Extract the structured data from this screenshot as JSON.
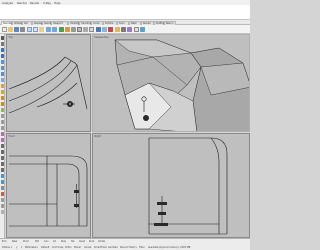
{
  "menu": [
    "Analyze",
    "Render",
    "Panels",
    "V-Ray",
    "Help"
  ],
  "tabs": [
    "Standard",
    "CPlanes",
    "Set View",
    "Display",
    "Select",
    "Viewport Layout",
    "Visibility",
    "Transform",
    "Curve Tools",
    "Surface Tools",
    "Solid Tools",
    "Mesh Tools",
    "Render Tools",
    "Drafting",
    "New in V7"
  ],
  "viewports": {
    "top": "Top",
    "perspective": "Perspective",
    "front": "Front",
    "right": "Right"
  },
  "osnaps": [
    "End",
    "Near",
    "Point",
    "Mid",
    "Cen",
    "Int",
    "Perp",
    "Tan",
    "Quad",
    "Knot",
    "Vertex"
  ],
  "status": {
    "cplane": "CPlane",
    "x": "x",
    "y": "y",
    "z": "z",
    "units": "Millimeters",
    "layer": "Default",
    "grid_snap": "Grid Snap",
    "ortho": "Ortho",
    "planar": "Planar",
    "osnap": "Osnap",
    "smarttrack": "SmartTrack",
    "gumball": "Gumball",
    "record_history": "Record History",
    "filter": "Filter",
    "memory": "Available physical memory: 1903 MB"
  },
  "colors": {
    "viewport_bg": "#bfbfbf",
    "active_border": "#b0b0b0",
    "line": "#1a1a1a"
  }
}
